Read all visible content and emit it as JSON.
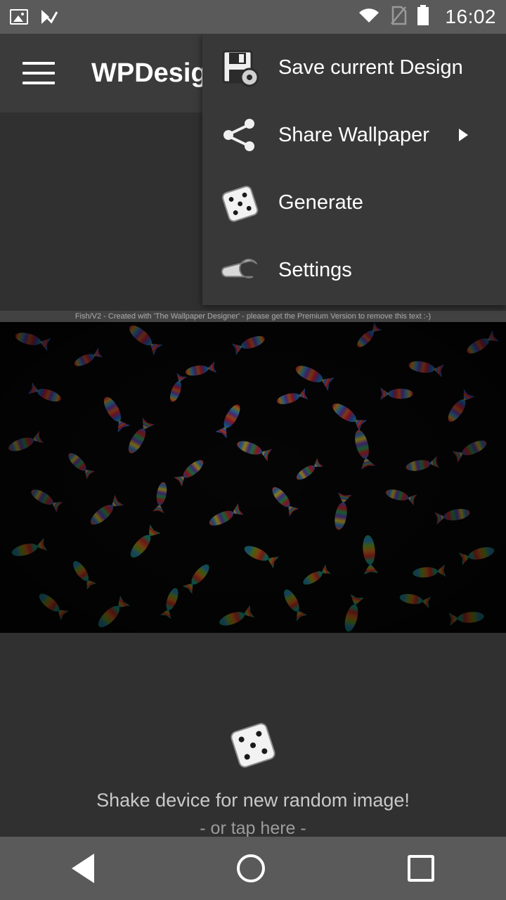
{
  "status_bar": {
    "time": "16:02",
    "icons": [
      "image-icon",
      "checklist-icon",
      "wifi-icon",
      "sim-off-icon",
      "battery-icon"
    ]
  },
  "app_bar": {
    "title": "WPDesigner",
    "menu_icon": "hamburger-menu-icon"
  },
  "menu": {
    "items": [
      {
        "label": "Save current Design",
        "icon": "save-disk-icon",
        "has_submenu": false
      },
      {
        "label": "Share Wallpaper",
        "icon": "share-icon",
        "has_submenu": true
      },
      {
        "label": "Generate",
        "icon": "dice-icon",
        "has_submenu": false
      },
      {
        "label": "Settings",
        "icon": "wrench-icon",
        "has_submenu": false
      }
    ]
  },
  "wallpaper": {
    "watermark": "Fish/V2 - Created with 'The Wallpaper Designer' - please get the Premium Version to remove this text :-)",
    "background_color": "#050505"
  },
  "shake_hint": {
    "icon": "dice-icon",
    "line1": "Shake device for new random image!",
    "line2": "- or tap here -"
  },
  "nav_bar": {
    "back": "back-triangle-icon",
    "home": "home-circle-icon",
    "recents": "recents-square-icon"
  },
  "colors": {
    "status_bar": "#5a5a5a",
    "app_bar": "#3b3b3b",
    "menu_bg": "#383838",
    "page_bg": "#303030",
    "text": "#ffffff"
  }
}
